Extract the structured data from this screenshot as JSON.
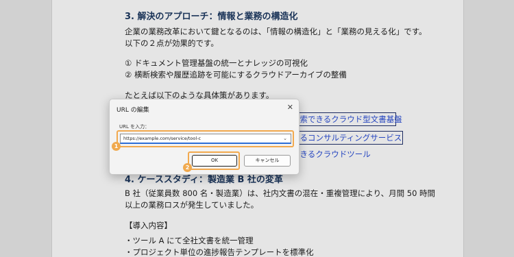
{
  "document": {
    "heading3": "3. 解決のアプローチ：情報と業務の構造化",
    "para1_line1": "企業の業務改革において鍵となるのは、「情報の構造化」と「業務の見える化」です。",
    "para1_line2": "以下の２点が効果的です。",
    "item1": "① ドキュメント管理基盤の統一とナレッジの可視化",
    "item2": "② 横断検索や履歴追跡を可能にするクラウドアーカイブの整備",
    "para2": "たとえば以下のような具体策があります。",
    "link1": "検索できるクラウド型文書基盤",
    "link2": "するコンサルティングサービス",
    "link3": "できるクラウドツール",
    "heading4": "4. ケーススタディ：製造業 B 社の変革",
    "para3_line1": "B 社（従業員数 800 名・製造業）は、社内文書の混在・重複管理により、月間 50 時間",
    "para3_line2": "以上の業務ロスが発生していました。",
    "section_label": "【導入内容】",
    "bullet1": "・ツール A にて全社文書を統一管理",
    "bullet2": "・プロジェクト単位の進捗報告テンプレートを標準化"
  },
  "dialog": {
    "title": "URL の編集",
    "close_glyph": "✕",
    "url_label": "URL を入力：",
    "url_value": "https://example.com/service/tool-c",
    "dropdown_glyph": "⌄",
    "ok_label": "OK",
    "cancel_label": "キャンセル"
  },
  "badges": {
    "step1": "1",
    "step2": "2"
  },
  "colors": {
    "highlight": "#f2a94e",
    "badge": "#f0a94e",
    "link": "#2b4fd6",
    "heading": "#1f3a63"
  }
}
